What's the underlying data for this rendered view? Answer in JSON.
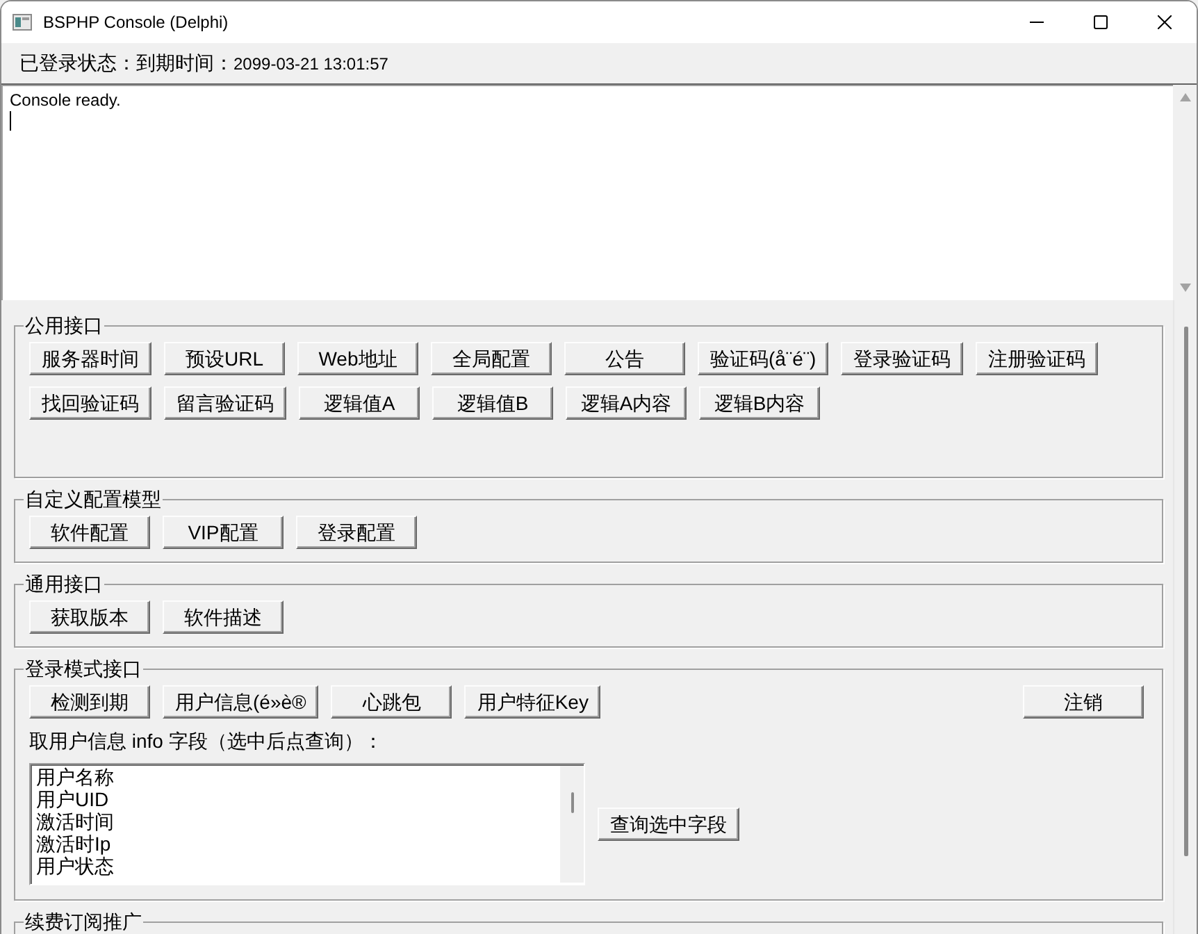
{
  "window": {
    "title": "BSPHP Console (Delphi)"
  },
  "status": {
    "label": "已登录状态：到期时间：",
    "value": "2099-03-21 13:01:57"
  },
  "console": {
    "lines": [
      "Console ready."
    ],
    "focused": true
  },
  "groups": [
    {
      "kind": "buttons",
      "title": "公用接口",
      "rows": [
        [
          "服务器时间",
          "预设URL",
          "Web地址",
          "全局配置",
          "公告",
          "验证码(å¨é¨)",
          "登录验证码",
          "注册验证码"
        ],
        [
          "找回验证码",
          "留言验证码",
          "逻辑值A",
          "逻辑值B",
          "逻辑A内容",
          "逻辑B内容"
        ]
      ]
    },
    {
      "kind": "buttons",
      "title": "自定义配置模型",
      "rows": [
        [
          "软件配置",
          "VIP配置",
          "登录配置"
        ]
      ]
    },
    {
      "kind": "buttons",
      "title": "通用接口",
      "rows": [
        [
          "获取版本",
          "软件描述"
        ]
      ]
    },
    {
      "kind": "login",
      "title": "登录模式接口",
      "buttons": [
        "检测到期",
        "用户信息(é»è®",
        "心跳包",
        "用户特征Key"
      ],
      "end_button": "注销",
      "field_label": "取用户信息 info 字段（选中后点查询）：",
      "fields": [
        {
          "label": "用户名称",
          "selected": false
        },
        {
          "label": "用户UID",
          "selected": false
        },
        {
          "label": "激活时间",
          "selected": false
        },
        {
          "label": "激活时Ip",
          "selected": false
        },
        {
          "label": "用户状态",
          "selected": false
        }
      ],
      "query_button": "查询选中字段"
    },
    {
      "kind": "buttons",
      "title": "续费订阅推广"
    }
  ]
}
